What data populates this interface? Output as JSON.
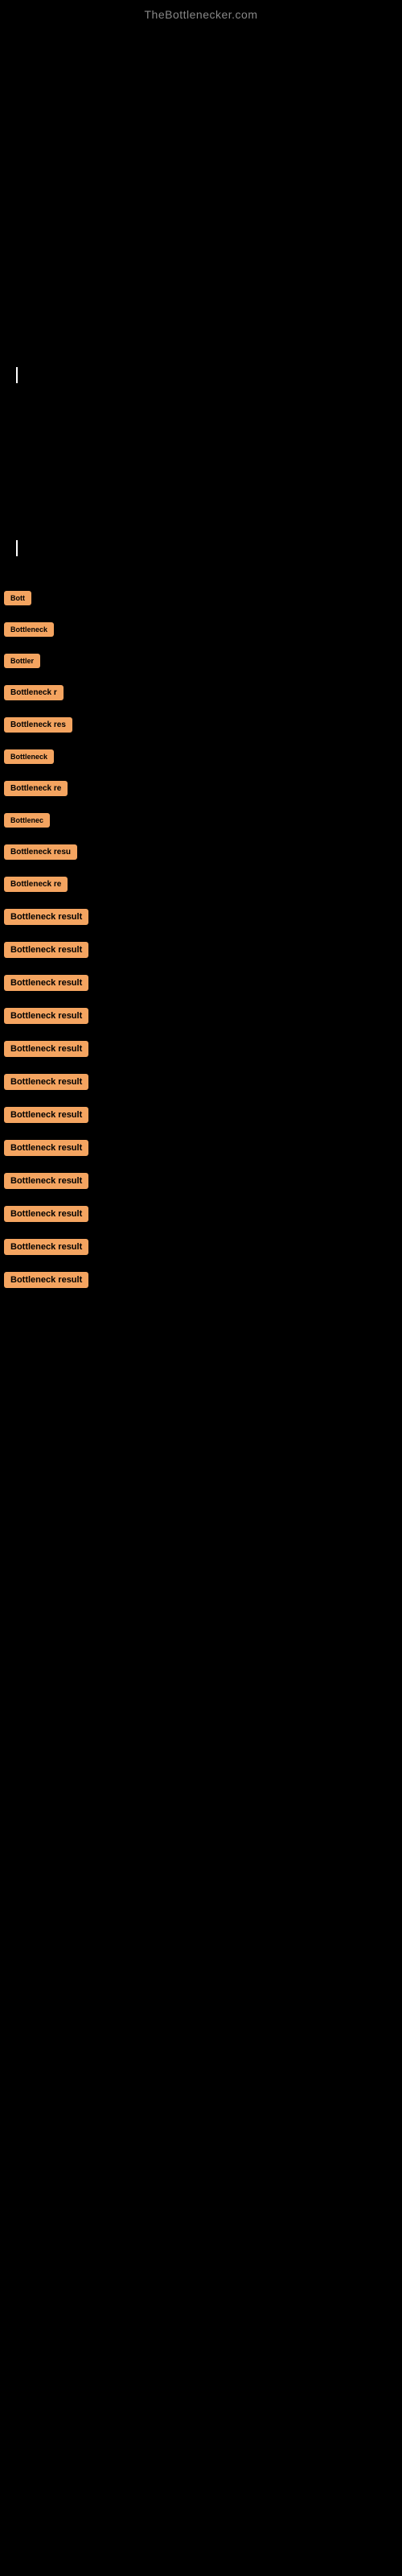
{
  "site": {
    "title": "TheBottlenecker.com"
  },
  "bottleneck_items": [
    {
      "id": 1,
      "label": "Bott",
      "size": "xs",
      "visible_chars": 4
    },
    {
      "id": 2,
      "label": "Bottleneck",
      "size": "sm",
      "visible_chars": 9
    },
    {
      "id": 3,
      "label": "Bottler",
      "size": "sm",
      "visible_chars": 7
    },
    {
      "id": 4,
      "label": "Bottleneck r",
      "size": "md",
      "visible_chars": 11
    },
    {
      "id": 5,
      "label": "Bottleneck res",
      "size": "md",
      "visible_chars": 14
    },
    {
      "id": 6,
      "label": "Bottleneck",
      "size": "sm",
      "visible_chars": 9
    },
    {
      "id": 7,
      "label": "Bottleneck re",
      "size": "md",
      "visible_chars": 13
    },
    {
      "id": 8,
      "label": "Bottlenec",
      "size": "sm",
      "visible_chars": 9
    },
    {
      "id": 9,
      "label": "Bottleneck resu",
      "size": "lg",
      "visible_chars": 15
    },
    {
      "id": 10,
      "label": "Bottleneck re",
      "size": "md",
      "visible_chars": 13
    },
    {
      "id": 11,
      "label": "Bottleneck result",
      "size": "xl",
      "visible_chars": 17
    },
    {
      "id": 12,
      "label": "Bottleneck result",
      "size": "xl",
      "visible_chars": 17
    },
    {
      "id": 13,
      "label": "Bottleneck result",
      "size": "xl",
      "visible_chars": 17
    },
    {
      "id": 14,
      "label": "Bottleneck result",
      "size": "xl",
      "visible_chars": 17
    },
    {
      "id": 15,
      "label": "Bottleneck result",
      "size": "xl",
      "visible_chars": 17
    },
    {
      "id": 16,
      "label": "Bottleneck result",
      "size": "xl",
      "visible_chars": 17
    },
    {
      "id": 17,
      "label": "Bottleneck result",
      "size": "xl",
      "visible_chars": 17
    },
    {
      "id": 18,
      "label": "Bottleneck result",
      "size": "xl",
      "visible_chars": 17
    },
    {
      "id": 19,
      "label": "Bottleneck result",
      "size": "xl",
      "visible_chars": 17
    },
    {
      "id": 20,
      "label": "Bottleneck result",
      "size": "xl",
      "visible_chars": 17
    },
    {
      "id": 21,
      "label": "Bottleneck result",
      "size": "xl",
      "visible_chars": 17
    },
    {
      "id": 22,
      "label": "Bottleneck result",
      "size": "xl",
      "visible_chars": 17
    }
  ],
  "colors": {
    "background": "#000000",
    "badge": "#F4A460",
    "text": "#888888"
  }
}
